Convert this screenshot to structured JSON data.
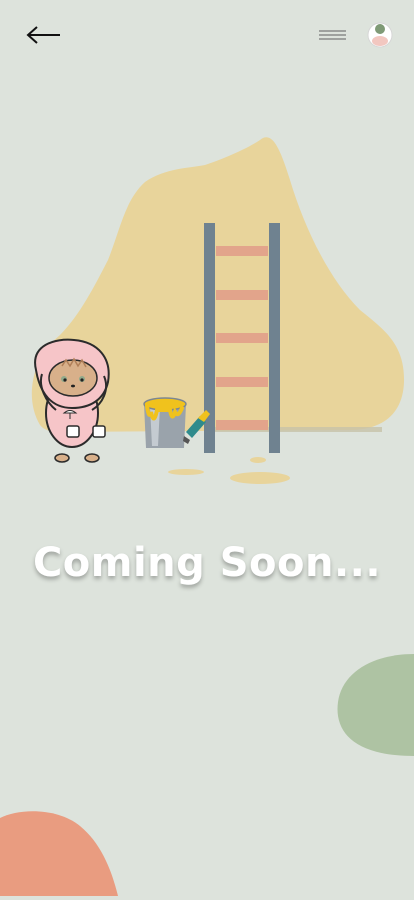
{
  "header": {
    "back_icon": "arrow-left-icon",
    "menu_icon": "hamburger-menu-icon",
    "avatar_icon": "user-avatar-icon"
  },
  "main": {
    "title": "Coming Soon..."
  },
  "colors": {
    "background": "#dde3dc",
    "blob_yellow": "#e8d49b",
    "ladder_rail": "#6f8290",
    "ladder_rung": "#e2a48b",
    "paint_yellow": "#f0c21d",
    "bucket_gray": "#9aa3ab",
    "hoodie_pink": "#f6c5c8",
    "blob_green": "#aec3a3",
    "blob_salmon": "#e99c80",
    "title_text": "#ffffff"
  }
}
